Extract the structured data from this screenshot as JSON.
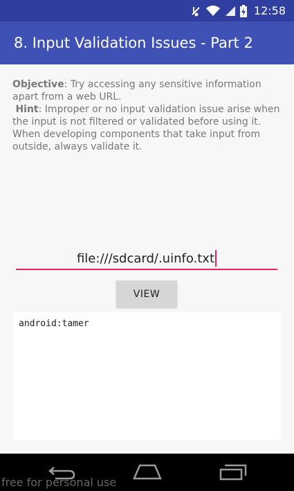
{
  "status_bar": {
    "time": "12:58",
    "icons": [
      "mute-icon",
      "wifi-icon",
      "signal-icon",
      "battery-charging-icon"
    ]
  },
  "app_bar": {
    "title": "8. Input Validation Issues - Part 2"
  },
  "description": {
    "objective_label": "Objective",
    "objective_text": ": Try accessing any sensitive information apart from a web URL.",
    "hint_label": "Hint",
    "hint_text": ": Improper or no input validation issue arise when the input is not filtered or validated before using it. When developing components that take input from outside, always validate it."
  },
  "url_input": {
    "value": "file:///sdcard/.uinfo.txt"
  },
  "view_button": {
    "label": "VIEW"
  },
  "output": {
    "text": "android:tamer"
  },
  "nav_bar": {
    "buttons": [
      "back-icon",
      "home-icon",
      "recents-icon"
    ]
  },
  "watermark": {
    "text": "free for personal use"
  },
  "colors": {
    "status_bar": "#303f9f",
    "app_bar": "#3f51b5",
    "input_underline": "#e91e63",
    "button": "#d6d6d6"
  }
}
